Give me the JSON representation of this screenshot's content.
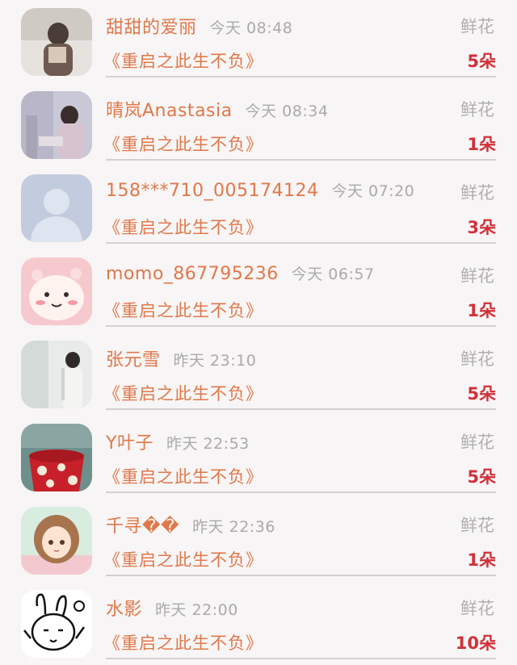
{
  "gift_label": "鲜花",
  "book_title": "《重启之此生不负》",
  "entries": [
    {
      "name": "甜甜的爱丽",
      "time": "今天 08:48",
      "count": "5朵",
      "avatar": "photo-avatar"
    },
    {
      "name": "晴岚Anastasia",
      "time": "今天 08:34",
      "count": "1朵",
      "avatar": "photo-avatar"
    },
    {
      "name": "158***710_005174124",
      "time": "今天 07:20",
      "count": "3朵",
      "avatar": "default-user-avatar"
    },
    {
      "name": "momo_867795236",
      "time": "今天 06:57",
      "count": "1朵",
      "avatar": "cartoon-avatar"
    },
    {
      "name": "张元雪",
      "time": "昨天 23:10",
      "count": "5朵",
      "avatar": "photo-avatar"
    },
    {
      "name": "Y叶子",
      "time": "昨天 22:53",
      "count": "5朵",
      "avatar": "cup-avatar"
    },
    {
      "name": "千寻��",
      "time": "昨天 22:36",
      "count": "1朵",
      "avatar": "anime-girl-avatar"
    },
    {
      "name": "水影",
      "time": "昨天 22:00",
      "count": "10朵",
      "avatar": "rabbit-sketch-avatar"
    }
  ]
}
